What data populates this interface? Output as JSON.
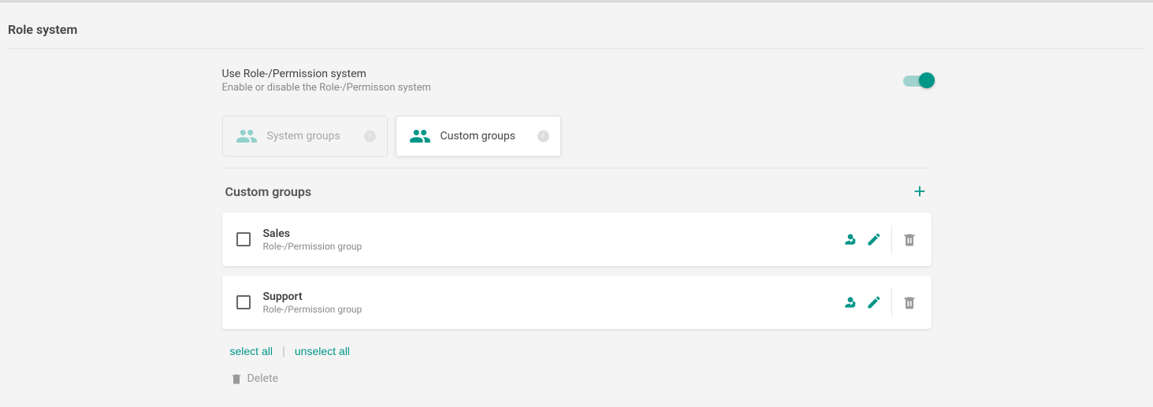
{
  "page": {
    "title": "Role system"
  },
  "toggle": {
    "title": "Use Role-/Permission system",
    "subtitle": "Enable or disable the Role-/Permisson system",
    "enabled": true
  },
  "tabs": {
    "system": {
      "label": "System groups",
      "active": false
    },
    "custom": {
      "label": "Custom groups",
      "active": true
    }
  },
  "section": {
    "title": "Custom groups"
  },
  "groups": [
    {
      "name": "Sales",
      "subtitle": "Role-/Permission group"
    },
    {
      "name": "Support",
      "subtitle": "Role-/Permission group"
    }
  ],
  "actions": {
    "select_all": "select all",
    "unselect_all": "unselect all",
    "delete": "Delete"
  }
}
